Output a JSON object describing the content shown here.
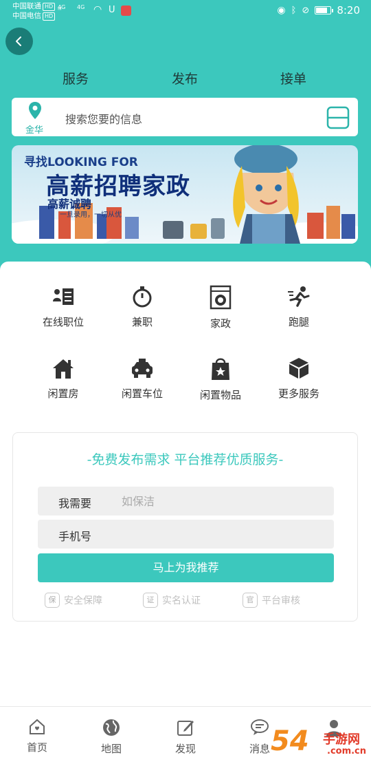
{
  "status_bar": {
    "carrier1": "中国联通",
    "carrier2": "中国电信",
    "hd": "HD",
    "net1": "4G",
    "net2": "4G",
    "time": "8:20"
  },
  "colors": {
    "accent": "#3cc8bd",
    "dark_teal": "#1a7d77"
  },
  "tabs": [
    "服务",
    "发布",
    "接单"
  ],
  "search": {
    "location": "金华",
    "placeholder": "搜索您要的信息"
  },
  "banner": {
    "line1": "寻找LOOKING FOR",
    "line2": "高薪招聘家政",
    "line3": "高薪诚聘",
    "line4": "一旦录用，一切从优"
  },
  "services": [
    {
      "label": "在线职位",
      "icon": "job-list-icon"
    },
    {
      "label": "兼职",
      "icon": "stopwatch-icon"
    },
    {
      "label": "家政",
      "icon": "washing-machine-icon"
    },
    {
      "label": "跑腿",
      "icon": "runner-icon"
    },
    {
      "label": "闲置房",
      "icon": "house-icon"
    },
    {
      "label": "闲置车位",
      "icon": "car-icon"
    },
    {
      "label": "闲置物品",
      "icon": "shopping-bag-icon"
    },
    {
      "label": "更多服务",
      "icon": "box-icon"
    }
  ],
  "form": {
    "title": "-免费发布需求 平台推荐优质服务-",
    "need_label": "我需要",
    "need_placeholder": "如保洁",
    "phone_label": "手机号",
    "phone_placeholder": "",
    "submit": "马上为我推荐",
    "badges": [
      {
        "icon_text": "保",
        "label": "安全保障"
      },
      {
        "icon_text": "证",
        "label": "实名认证"
      },
      {
        "icon_text": "官",
        "label": "平台审核"
      }
    ]
  },
  "bottom_nav": [
    {
      "label": "首页",
      "icon": "home-icon"
    },
    {
      "label": "地图",
      "icon": "globe-icon"
    },
    {
      "label": "发现",
      "icon": "edit-icon"
    },
    {
      "label": "消息",
      "icon": "chat-icon"
    },
    {
      "label": "",
      "icon": "person-icon"
    }
  ],
  "watermark": {
    "text1": "54",
    "text2": "手游网",
    "text3": ".com.cn"
  }
}
